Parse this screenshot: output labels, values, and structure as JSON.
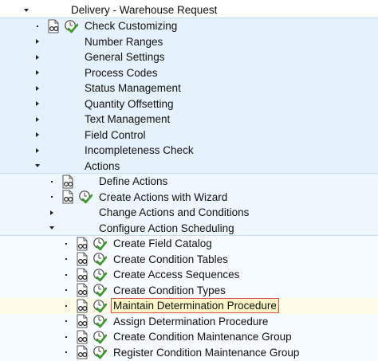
{
  "tree": {
    "root": {
      "label": "Delivery - Warehouse Request",
      "expanded": true
    },
    "items": [
      {
        "label": "Check Customizing",
        "level": 1,
        "type": "leaf",
        "icons": [
          "document-glasses-icon",
          "clock-check-icon"
        ]
      },
      {
        "label": "Number Ranges",
        "level": 1,
        "type": "folder",
        "expanded": false
      },
      {
        "label": "General Settings",
        "level": 1,
        "type": "folder",
        "expanded": false
      },
      {
        "label": "Process Codes",
        "level": 1,
        "type": "folder",
        "expanded": false
      },
      {
        "label": "Status Management",
        "level": 1,
        "type": "folder",
        "expanded": false
      },
      {
        "label": "Quantity Offsetting",
        "level": 1,
        "type": "folder",
        "expanded": false
      },
      {
        "label": "Text Management",
        "level": 1,
        "type": "folder",
        "expanded": false
      },
      {
        "label": "Field Control",
        "level": 1,
        "type": "folder",
        "expanded": false
      },
      {
        "label": "Incompleteness Check",
        "level": 1,
        "type": "folder",
        "expanded": false
      },
      {
        "label": "Actions",
        "level": 1,
        "type": "folder",
        "expanded": true
      },
      {
        "label": "Define Actions",
        "level": 2,
        "type": "leaf",
        "icons": [
          "document-glasses-icon"
        ]
      },
      {
        "label": "Create Actions with Wizard",
        "level": 2,
        "type": "leaf",
        "icons": [
          "document-glasses-icon",
          "clock-check-icon"
        ]
      },
      {
        "label": "Change Actions and Conditions",
        "level": 2,
        "type": "folder",
        "expanded": false
      },
      {
        "label": "Configure Action Scheduling",
        "level": 2,
        "type": "folder",
        "expanded": true
      },
      {
        "label": "Create Field Catalog",
        "level": 3,
        "type": "leaf",
        "icons": [
          "document-glasses-icon",
          "clock-check-icon"
        ]
      },
      {
        "label": "Create Condition Tables",
        "level": 3,
        "type": "leaf",
        "icons": [
          "document-glasses-icon",
          "clock-check-icon"
        ]
      },
      {
        "label": "Create Access Sequences",
        "level": 3,
        "type": "leaf",
        "icons": [
          "document-glasses-icon",
          "clock-check-icon"
        ]
      },
      {
        "label": "Create Condition Types",
        "level": 3,
        "type": "leaf",
        "icons": [
          "document-glasses-icon",
          "clock-check-icon"
        ]
      },
      {
        "label": "Maintain Determination Procedure",
        "level": 3,
        "type": "leaf",
        "selected": true,
        "icons": [
          "document-glasses-icon",
          "clock-check-icon"
        ]
      },
      {
        "label": "Assign Determination Procedure",
        "level": 3,
        "type": "leaf",
        "icons": [
          "document-glasses-icon",
          "clock-check-icon"
        ]
      },
      {
        "label": "Create Condition Maintenance Group",
        "level": 3,
        "type": "leaf",
        "icons": [
          "document-glasses-icon",
          "clock-check-icon"
        ]
      },
      {
        "label": "Register Condition Maintenance Group",
        "level": 3,
        "type": "leaf",
        "icons": [
          "document-glasses-icon",
          "clock-check-icon"
        ]
      }
    ]
  },
  "colors": {
    "selection_border": "#e05050",
    "selection_fill": "#fff6c8",
    "clock_check": "#3a9b2a"
  }
}
